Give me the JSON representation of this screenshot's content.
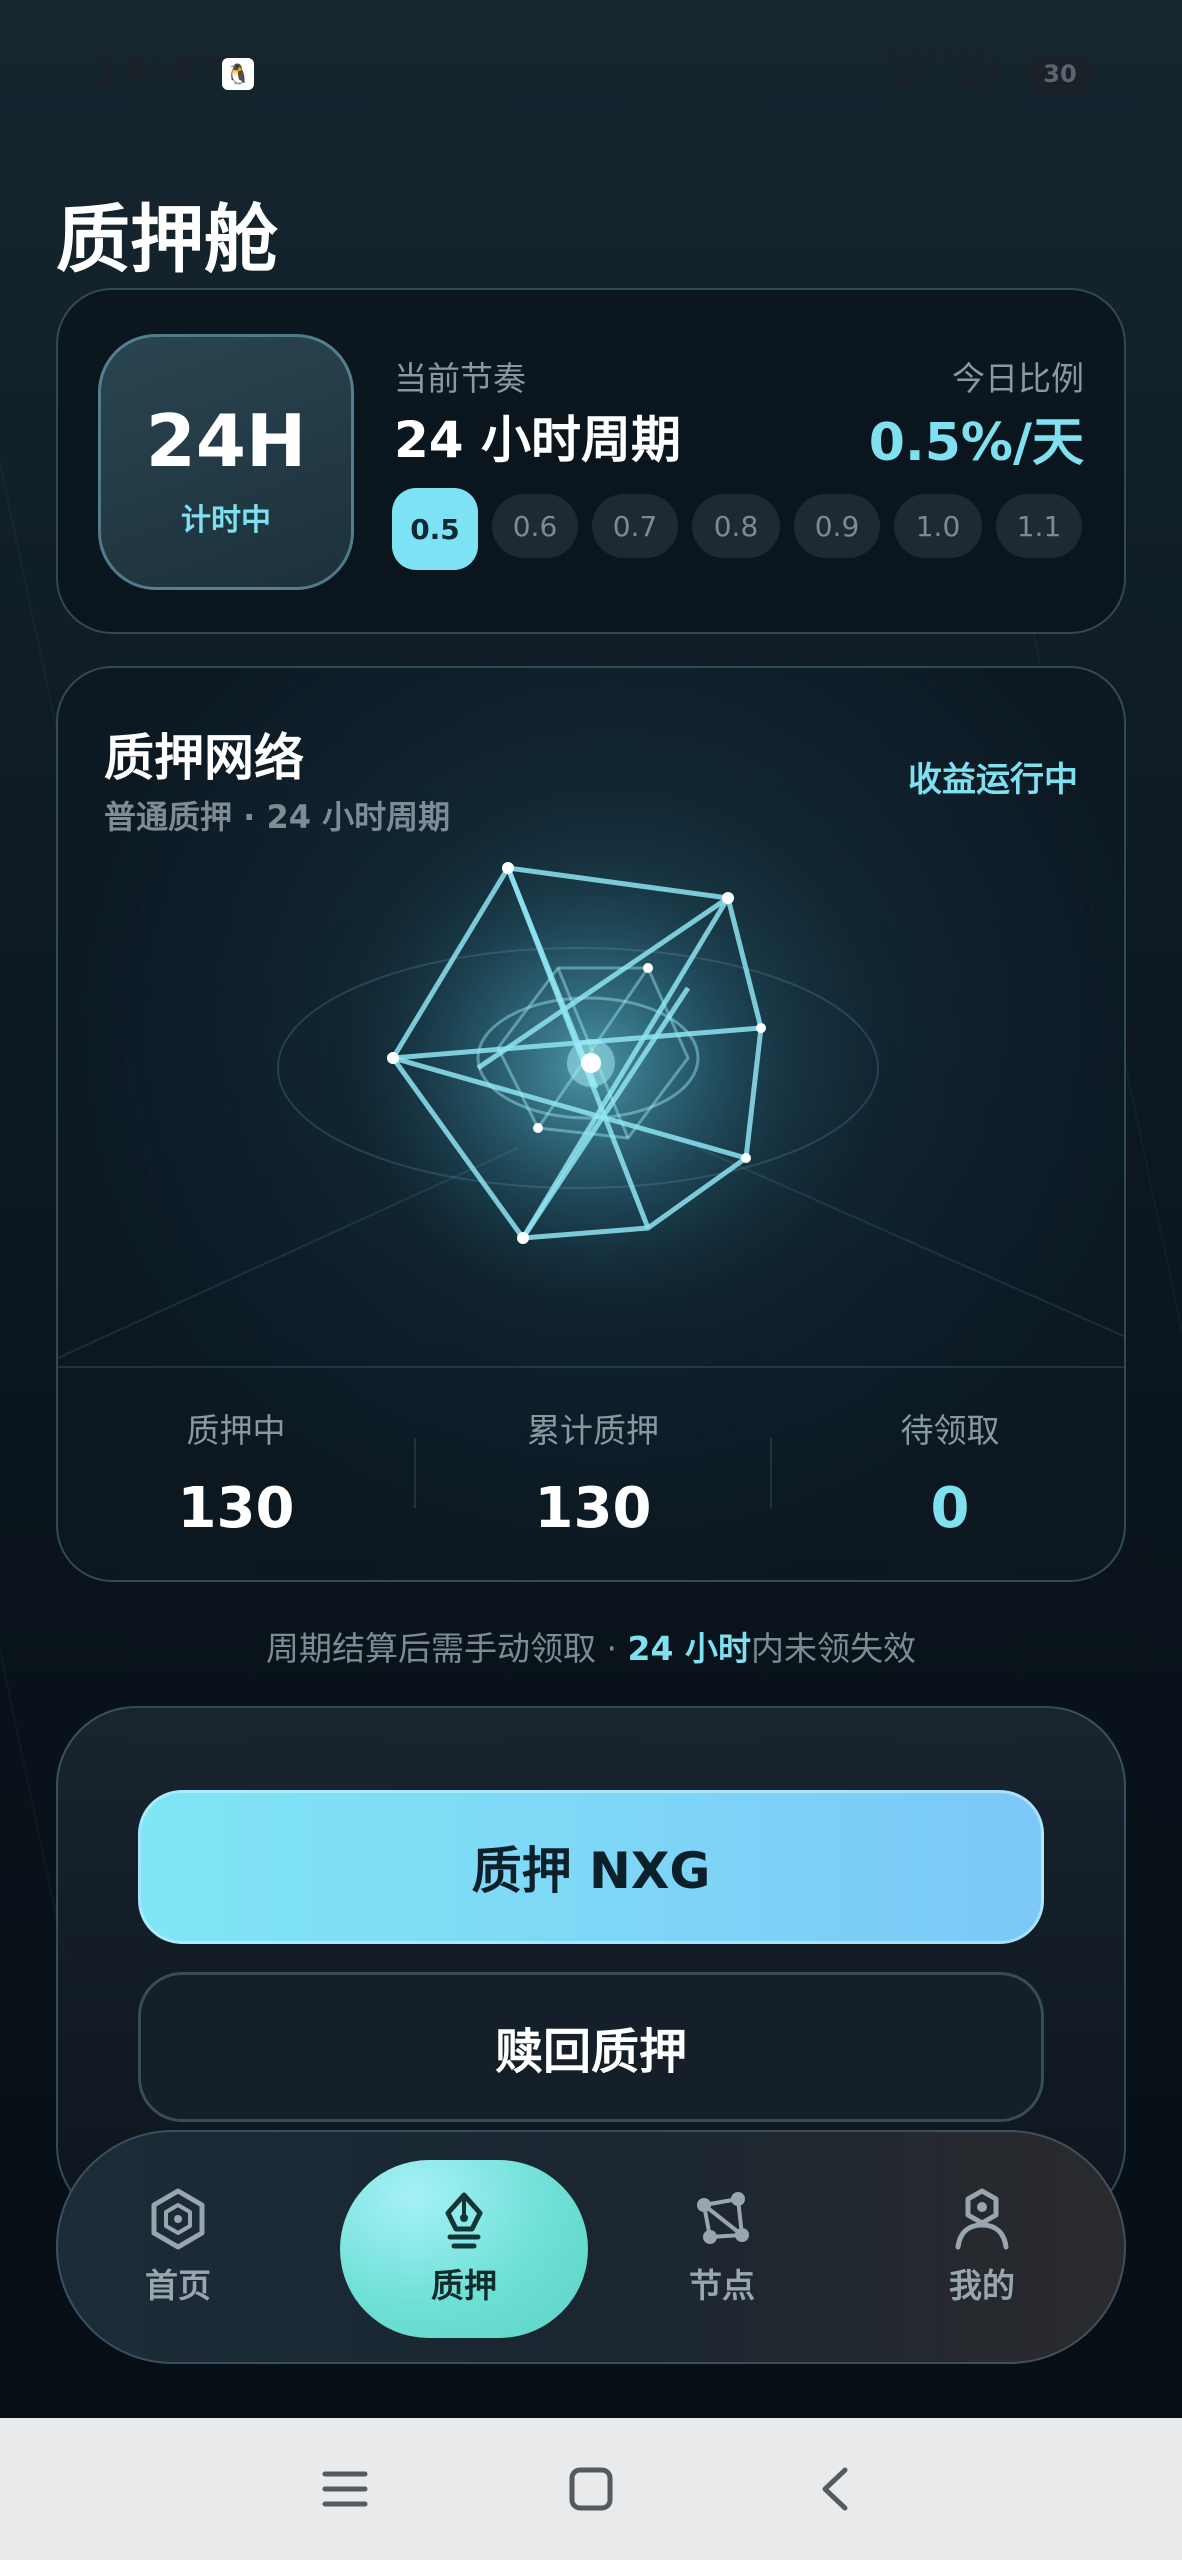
{
  "status_bar": {
    "time": "14:47",
    "speed_top": "9.23",
    "speed_unit": "KB/s",
    "network": "5GA",
    "battery": "30"
  },
  "page": {
    "title": "质押舱"
  },
  "rhythm": {
    "timer_big": "24H",
    "timer_sub": "计时中",
    "current_label": "当前节奏",
    "current_value": "24 小时周期",
    "ratio_label": "今日比例",
    "ratio_value": "0.5%/天",
    "options": [
      "0.5",
      "0.6",
      "0.7",
      "0.8",
      "0.9",
      "1.0",
      "1.1"
    ],
    "selected": "0.5"
  },
  "network": {
    "title": "质押网络",
    "subtitle": "普通质押 · 24 小时周期",
    "status": "收益运行中",
    "stats": [
      {
        "label": "质押中",
        "value": "130"
      },
      {
        "label": "累计质押",
        "value": "130"
      },
      {
        "label": "待领取",
        "value": "0"
      }
    ]
  },
  "notice": {
    "before": "周期结算后需手动领取 · ",
    "highlight": "24 小时",
    "after": "内未领失效"
  },
  "actions": {
    "stake": "质押 NXG",
    "redeem": "赎回质押"
  },
  "nav": {
    "items": [
      {
        "label": "首页",
        "icon": "home-hexagon-icon"
      },
      {
        "label": "质押",
        "icon": "stake-pen-icon"
      },
      {
        "label": "节点",
        "icon": "node-graph-icon"
      },
      {
        "label": "我的",
        "icon": "profile-icon"
      }
    ],
    "active": "质押"
  },
  "colors": {
    "accent": "#7fe0f0",
    "background": "#0b1620",
    "nav_active": "#6ee0d6"
  }
}
